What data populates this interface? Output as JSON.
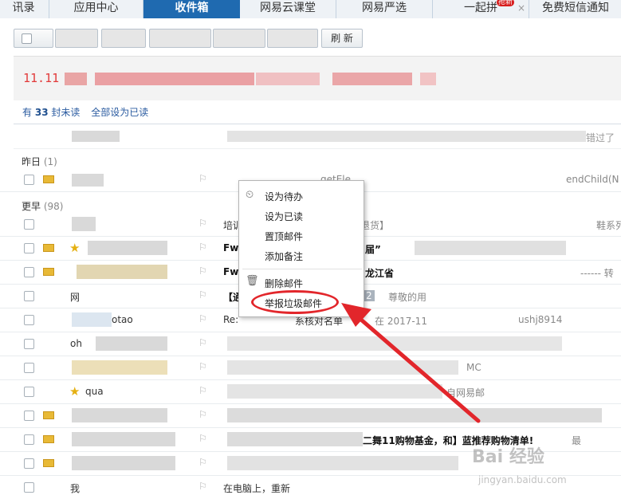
{
  "tabs": [
    {
      "label": "讯录",
      "active": false
    },
    {
      "label": "应用中心",
      "active": false
    },
    {
      "label": "收件箱",
      "active": true
    },
    {
      "label": "网易云课堂",
      "active": false
    },
    {
      "label": "网易严选",
      "active": false
    },
    {
      "label": "一起拼",
      "badge": "抢新",
      "active": false
    },
    {
      "label": "免费短信通知",
      "active": false
    }
  ],
  "toolbar": {
    "refresh_label": "刷 新"
  },
  "banner": {
    "ad_text": "11.11"
  },
  "unread": {
    "prefix": "有",
    "count": "33",
    "suffix": "封未读",
    "mark_all": "全部设为已读"
  },
  "missed_label": "错过了",
  "groups": {
    "yesterday": {
      "label": "昨日",
      "count": "(1)"
    },
    "earlier": {
      "label": "更早",
      "count": "(98)"
    }
  },
  "rows": [
    {
      "subject": "getEle",
      "summary": "endChild(N",
      "unread": true
    },
    {
      "subject": "培训",
      "summary": "退货】",
      "summary2": "鞋系列",
      "unread": false
    },
    {
      "subject": "Fw",
      "summary": "届”",
      "unread": true,
      "starred": true
    },
    {
      "subject": "Fw",
      "summary": "龙江省",
      "summary2": "------ 转",
      "unread": true
    },
    {
      "sender": "网",
      "subject": "【通",
      "summary": "2",
      "summary2": "尊敬的用",
      "unread": false
    },
    {
      "sender": "otao",
      "subject": "Re:",
      "summary": "系核对名单",
      "summary2": "在 2017-11",
      "summary3": "ushj8914",
      "unread": false
    },
    {
      "sender": "oh",
      "subject": "",
      "unread": false
    },
    {
      "subject": "",
      "summary": "MC",
      "unread": false
    },
    {
      "sender": "qua",
      "subject": "",
      "summary": "自网易邮",
      "unread": false,
      "starred": true
    },
    {
      "sender": "",
      "subject": "",
      "unread": true
    },
    {
      "sender": "",
      "subject": "",
      "summary": "二舞11购物基金，和】蓝推荐购物清单!",
      "summary2": "最",
      "unread": true
    },
    {
      "sender": "",
      "subject": "",
      "unread": true
    },
    {
      "sender": "我",
      "subject": "在电脑上，重新",
      "unread": false
    }
  ],
  "context_menu": {
    "items": [
      {
        "label": "设为待办",
        "icon": "clock-icon"
      },
      {
        "label": "设为已读"
      },
      {
        "label": "置顶邮件"
      },
      {
        "label": "添加备注"
      },
      {
        "label": "删除邮件",
        "icon": "trash-icon"
      },
      {
        "label": "举报垃圾邮件"
      }
    ]
  },
  "watermark": {
    "brand": "Bai 经验",
    "url": "jingyan.baidu.com"
  },
  "colors": {
    "accent": "#1f6ab0",
    "highlight": "#e2262b",
    "unread_icon": "#e8b936"
  }
}
